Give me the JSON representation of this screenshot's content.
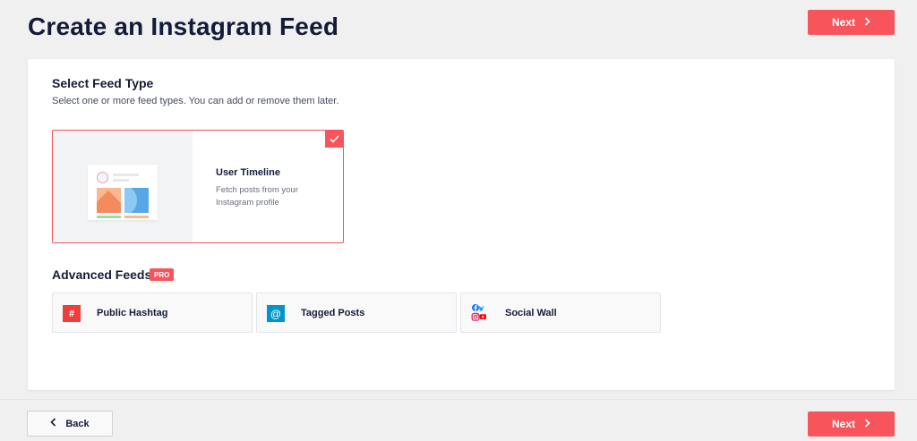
{
  "header": {
    "title": "Create an Instagram Feed",
    "next_label": "Next",
    "next_icon": "chevron-right-icon"
  },
  "feed_type": {
    "title": "Select Feed Type",
    "description": "Select one or more feed types. You can add or remove them later.",
    "options": [
      {
        "name": "User Timeline",
        "description": "Fetch posts from your Instagram profile",
        "selected": true
      }
    ]
  },
  "advanced_feeds": {
    "title": "Advanced Feeds",
    "badge": "PRO",
    "items": [
      {
        "label": "Public Hashtag",
        "icon": "hashtag-icon",
        "icon_symbol": "#"
      },
      {
        "label": "Tagged Posts",
        "icon": "at-sign-icon",
        "icon_symbol": "@"
      },
      {
        "label": "Social Wall",
        "icon": "social-networks-icon"
      }
    ]
  },
  "footer": {
    "back_label": "Back",
    "back_icon": "chevron-left-icon",
    "next_label": "Next",
    "next_icon": "chevron-right-icon"
  },
  "colors": {
    "accent": "#f7545b",
    "hashtag": "#ee3e3b",
    "tagged": "#0096cc",
    "facebook": "#1877f2",
    "twitter": "#1da1f2",
    "instagram": "#e1306c",
    "youtube": "#ff0000",
    "background": "#f0f0f1",
    "text": "#141b38"
  }
}
